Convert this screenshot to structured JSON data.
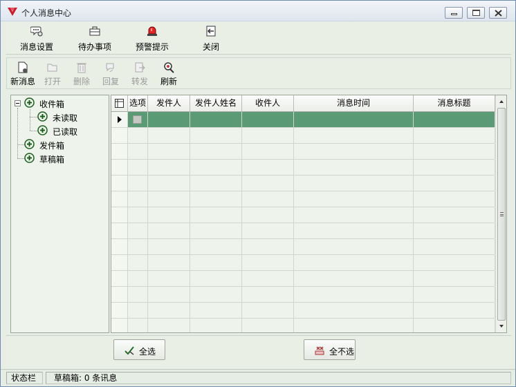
{
  "window": {
    "title": "个人消息中心",
    "controls": {
      "minimize": "minimize-icon",
      "maximize": "maximize-icon",
      "close": "close-icon"
    }
  },
  "top_toolbar": {
    "items": [
      {
        "label": "消息设置",
        "icon": "message-settings-icon"
      },
      {
        "label": "待办事项",
        "icon": "briefcase-icon"
      },
      {
        "label": "预警提示",
        "icon": "alarm-light-icon"
      },
      {
        "label": "关闭",
        "icon": "exit-icon"
      }
    ]
  },
  "message_toolbar": {
    "items": [
      {
        "label": "新消息",
        "icon": "new-message-icon",
        "enabled": true
      },
      {
        "label": "打开",
        "icon": "open-folder-icon",
        "enabled": false
      },
      {
        "label": "删除",
        "icon": "trash-icon",
        "enabled": false
      },
      {
        "label": "回复",
        "icon": "reply-icon",
        "enabled": false
      },
      {
        "label": "转发",
        "icon": "forward-icon",
        "enabled": false
      },
      {
        "label": "刷新",
        "icon": "refresh-search-icon",
        "enabled": true
      }
    ]
  },
  "tree": {
    "inbox": "收件箱",
    "unread": "未读取",
    "read": "已读取",
    "outbox": "发件箱",
    "drafts": "草稿箱"
  },
  "grid": {
    "columns": [
      "选项",
      "发件人",
      "发件人姓名",
      "收件人",
      "消息时间",
      "消息标题"
    ],
    "selected_row_color": "#5a9a75"
  },
  "actions": {
    "select_all": "全选",
    "deselect_all": "全不选"
  },
  "status": {
    "label": "状态栏",
    "message": "草稿箱: 0 条讯息"
  }
}
